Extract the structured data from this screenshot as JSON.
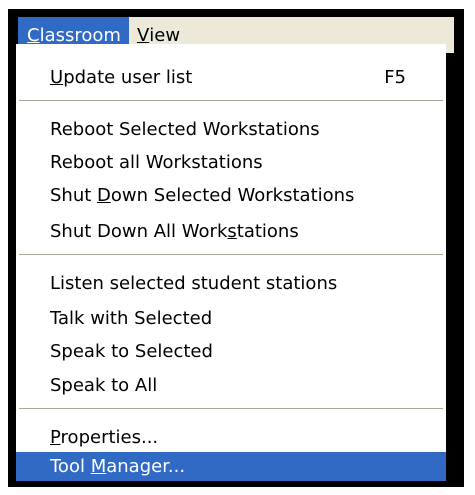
{
  "menubar": {
    "classroom": {
      "pre": "",
      "key": "C",
      "post": "lassroom"
    },
    "view": {
      "pre": "",
      "key": "V",
      "post": "iew"
    }
  },
  "menu": {
    "update_user_list": {
      "pre": "",
      "key": "U",
      "post": "pdate user list",
      "shortcut": "F5"
    },
    "reboot_selected": {
      "label": "Reboot Selected Workstations"
    },
    "reboot_all": {
      "label": "Reboot all Workstations"
    },
    "shut_down_selected": {
      "pre": "Shut ",
      "key": "D",
      "post": "own Selected Workstations"
    },
    "shut_down_all": {
      "pre": "Shut Down All Work",
      "key": "s",
      "post": "tations"
    },
    "listen_selected": {
      "label": "Listen selected student stations"
    },
    "talk_selected": {
      "label": "Talk with Selected"
    },
    "speak_selected": {
      "label": "Speak to Selected"
    },
    "speak_all": {
      "label": "Speak to All"
    },
    "properties": {
      "pre": "",
      "key": "P",
      "post": "roperties..."
    },
    "tool_manager": {
      "pre": "Tool ",
      "key": "M",
      "post": "anager..."
    }
  },
  "colors": {
    "highlight": "#316ac5",
    "menubar_bg": "#ece9d8",
    "frame": "#000000",
    "separator": "#aca899"
  }
}
